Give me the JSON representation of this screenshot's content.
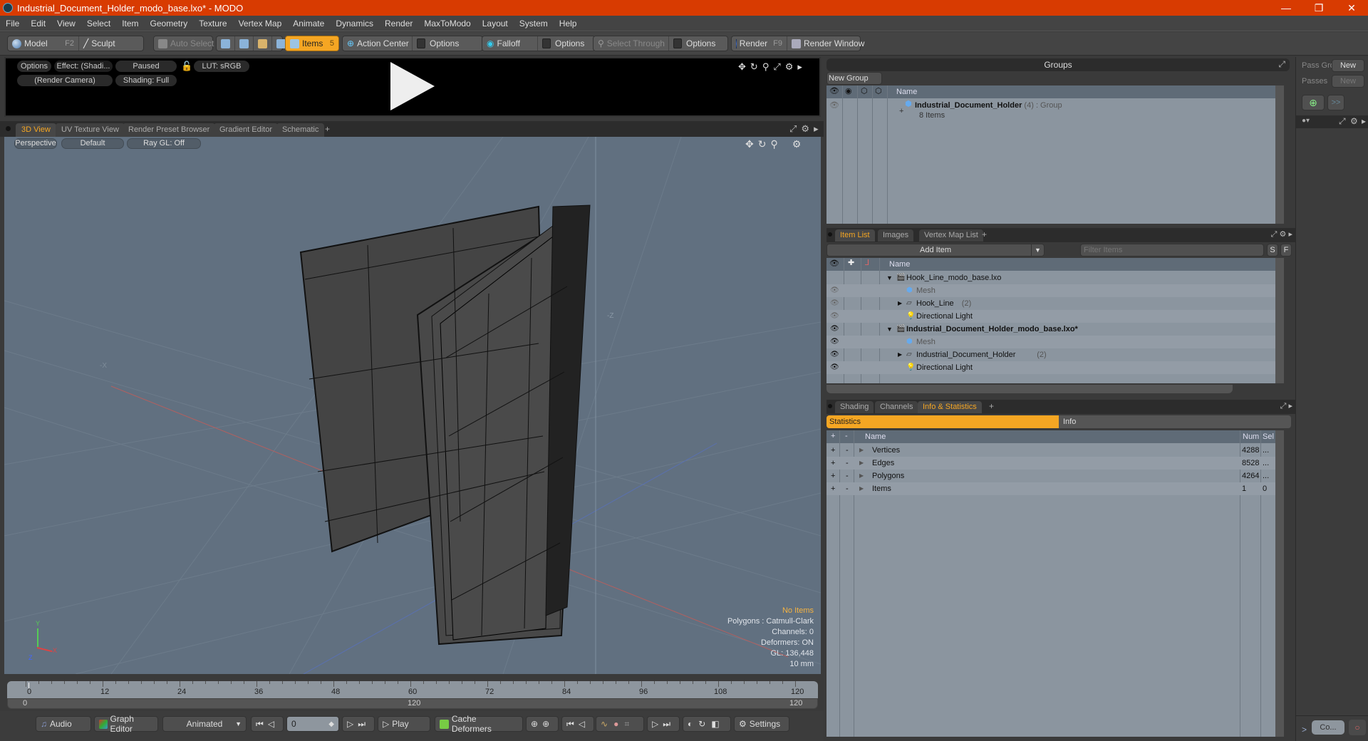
{
  "window": {
    "title": "Industrial_Document_Holder_modo_base.lxo* - MODO",
    "minimize": "—",
    "restore": "❐",
    "close": "✕"
  },
  "menu": [
    "File",
    "Edit",
    "View",
    "Select",
    "Item",
    "Geometry",
    "Texture",
    "Vertex Map",
    "Animate",
    "Dynamics",
    "Render",
    "MaxToModo",
    "Layout",
    "System",
    "Help"
  ],
  "toolbar": {
    "model": "Model",
    "model_key": "F2",
    "sculpt": "Sculpt",
    "auto_select": "Auto Select",
    "items": "Items",
    "items_key": "5",
    "action_center": "Action Center",
    "options1": "Options",
    "falloff": "Falloff",
    "options2": "Options",
    "select_through": "Select Through",
    "options3": "Options",
    "render": "Render",
    "render_key": "F9",
    "render_window": "Render Window"
  },
  "preview": {
    "options": "Options",
    "effect": "Effect: (Shadi...",
    "paused": "Paused",
    "lut": "LUT: sRGB",
    "camera": "(Render Camera)",
    "shading": "Shading: Full"
  },
  "viewport_tabs": [
    "3D View",
    "UV Texture View",
    "Render Preset Browser",
    "Gradient Editor",
    "Schematic"
  ],
  "viewport_tab_add": "+",
  "viewport": {
    "perspective": "Perspective",
    "default": "Default",
    "raygl": "Ray GL: Off",
    "axis_neg_z": "-Z",
    "axis_neg_x": "-X",
    "hud": {
      "selection": "No Items",
      "polygons": "Polygons : Catmull-Clark",
      "channels": "Channels: 0",
      "deformers": "Deformers: ON",
      "gl": "GL: 136,448",
      "unit": "10 mm"
    },
    "gizmo": {
      "x": "X",
      "y": "Y",
      "z": "Z"
    }
  },
  "timeline": {
    "ticks": [
      "0",
      "12",
      "24",
      "36",
      "48",
      "60",
      "72",
      "84",
      "96",
      "108",
      "120"
    ],
    "range_start": "0",
    "range_mid": "120",
    "range_end": "120",
    "current_frame": "0"
  },
  "bottombar": {
    "audio": "Audio",
    "graph_editor": "Graph Editor",
    "animated": "Animated",
    "frame": "0",
    "play": "Play",
    "cache_deformers": "Cache Deformers",
    "settings": "Settings"
  },
  "groups": {
    "title": "Groups",
    "new_group": "New Group",
    "col_name": "Name",
    "rows": [
      {
        "name": "Industrial_Document_Holder",
        "count": "(4)",
        "type": ": Group",
        "sub": "8 Items"
      }
    ]
  },
  "passes": {
    "pass_groups": "Pass Gro",
    "passes": "Passes",
    "new1": "New",
    "new2": "New",
    "more": ">>"
  },
  "itemlist": {
    "tabs": [
      "Item List",
      "Images",
      "Vertex Map List"
    ],
    "tab_add": "+",
    "add_item": "Add Item",
    "filter_placeholder": "Filter Items",
    "s": "S",
    "f": "F",
    "col_name": "Name",
    "rows": [
      {
        "name": "Hook_Line_modo_base.lxo",
        "suffix": "",
        "kind": "scene",
        "level": 0
      },
      {
        "name": "Mesh",
        "suffix": "",
        "kind": "mesh",
        "level": 1
      },
      {
        "name": "Hook_Line",
        "suffix": "(2)",
        "kind": "group",
        "level": 1
      },
      {
        "name": "Directional Light",
        "suffix": "",
        "kind": "light",
        "level": 1
      },
      {
        "name": "Industrial_Document_Holder_modo_base.lxo*",
        "suffix": "",
        "kind": "scene",
        "level": 0
      },
      {
        "name": "Mesh",
        "suffix": "",
        "kind": "mesh",
        "level": 1
      },
      {
        "name": "Industrial_Document_Holder",
        "suffix": "(2)",
        "kind": "group",
        "level": 1
      },
      {
        "name": "Directional Light",
        "suffix": "",
        "kind": "light",
        "level": 1
      }
    ]
  },
  "stats": {
    "tabs": [
      "Shading",
      "Channels",
      "Info & Statistics"
    ],
    "tab_add": "+",
    "sub_statistics": "Statistics",
    "sub_info": "Info",
    "col_name": "Name",
    "col_num": "Num",
    "col_sel": "Sel",
    "rows": [
      {
        "name": "Vertices",
        "num": "4288",
        "sel": "..."
      },
      {
        "name": "Edges",
        "num": "8528",
        "sel": "..."
      },
      {
        "name": "Polygons",
        "num": "4264",
        "sel": "..."
      },
      {
        "name": "Items",
        "num": "1",
        "sel": "0"
      }
    ]
  },
  "command": {
    "prompt": ">",
    "placeholder": "Co..."
  },
  "colors": {
    "accent": "#f5a623",
    "titlebar": "#d83b01"
  }
}
